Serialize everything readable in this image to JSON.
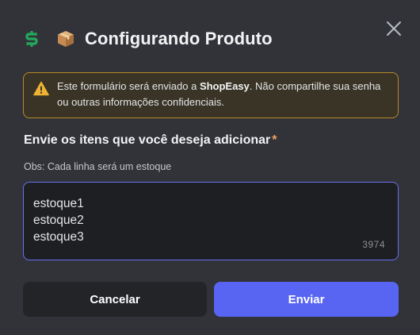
{
  "modal": {
    "title": "Configurando Produto",
    "app_icon": "dollar-s-logo-icon",
    "title_emoji": "package-box-icon",
    "close_icon": "close-icon"
  },
  "warning": {
    "icon": "warning-triangle-icon",
    "text_before": "Este formulário será enviado a ",
    "app_name": "ShopEasy",
    "text_after": ". Não compartilhe sua senha ou outras informações confidenciais.",
    "border_color": "#b7892a"
  },
  "field": {
    "label": "Envie os itens que você deseja adicionar",
    "required_mark": "*",
    "hint": "Obs: Cada linha será um estoque",
    "lines": [
      "estoque1",
      "estoque2",
      "estoque3"
    ],
    "remaining_chars": "3974",
    "focus_color": "#6a6ff2"
  },
  "buttons": {
    "cancel_label": "Cancelar",
    "submit_label": "Enviar",
    "submit_color": "#5865f2"
  }
}
